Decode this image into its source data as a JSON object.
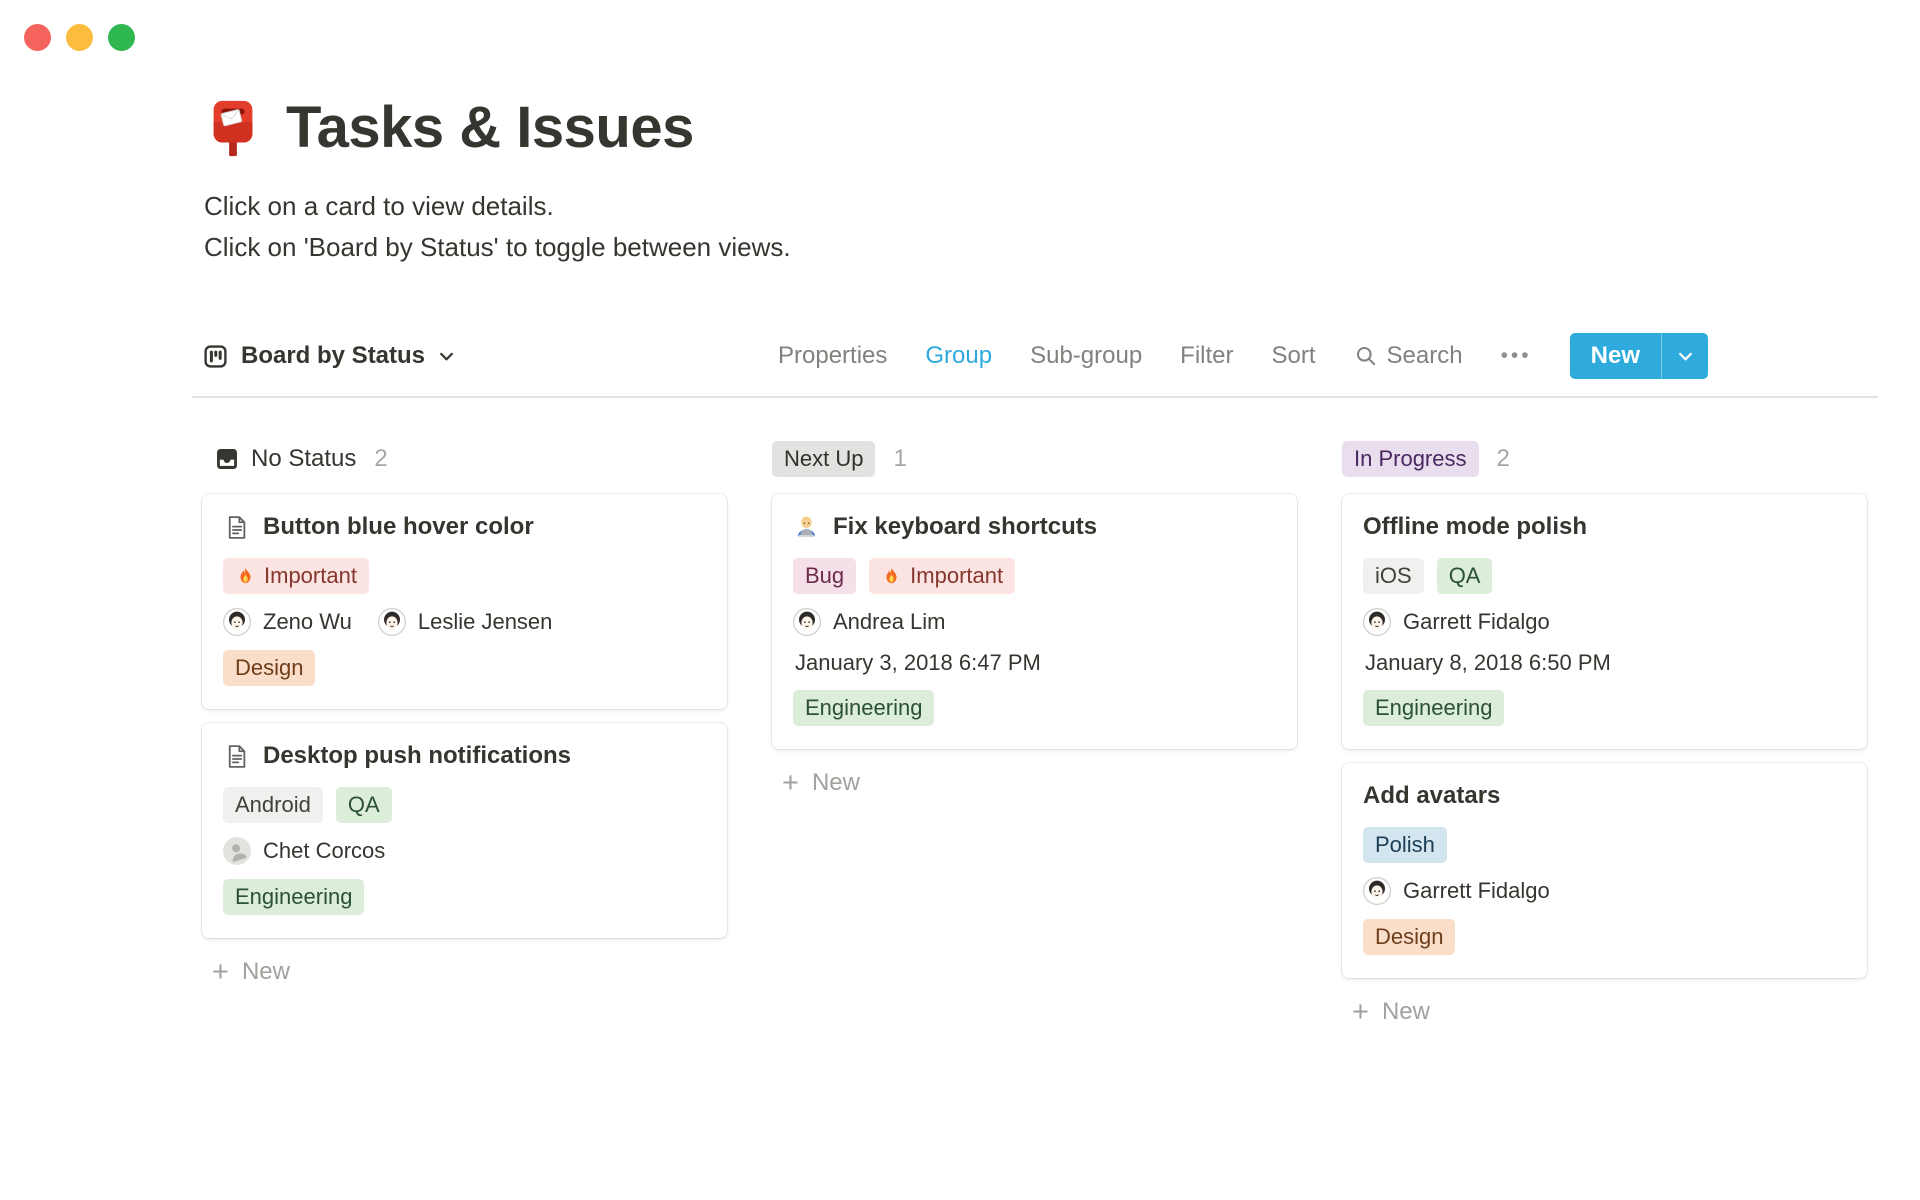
{
  "page": {
    "icon": "postbox",
    "title": "Tasks & Issues",
    "description_lines": [
      "Click on a card to view details.",
      "Click on 'Board by Status' to toggle between views."
    ]
  },
  "toolbar": {
    "view_selector": {
      "icon": "board",
      "label": "Board by Status"
    },
    "menu_items": [
      {
        "label": "Properties",
        "active": false
      },
      {
        "label": "Group",
        "active": true
      },
      {
        "label": "Sub-group",
        "active": false
      },
      {
        "label": "Filter",
        "active": false
      },
      {
        "label": "Sort",
        "active": false
      }
    ],
    "search_label": "Search",
    "more_label": "•••",
    "new_button_label": "New"
  },
  "board": {
    "columns": [
      {
        "title": "No Status",
        "count": "2",
        "header_style": "icon-plain",
        "header_icon": "inbox",
        "new_label": "New",
        "cards": [
          {
            "icon": "page",
            "title": "Button blue hover color",
            "tags": [
              {
                "label": "Important",
                "color": "red",
                "icon": "fire"
              }
            ],
            "people": [
              {
                "name": "Zeno Wu",
                "avatar": "photo"
              },
              {
                "name": "Leslie Jensen",
                "avatar": "photo"
              }
            ],
            "bottom_tags": [
              {
                "label": "Design",
                "color": "orange"
              }
            ]
          },
          {
            "icon": "page",
            "title": "Desktop push notifications",
            "tags": [
              {
                "label": "Android",
                "color": "lightgray"
              },
              {
                "label": "QA",
                "color": "green"
              }
            ],
            "people": [
              {
                "name": "Chet Corcos",
                "avatar": "placeholder"
              }
            ],
            "bottom_tags": [
              {
                "label": "Engineering",
                "color": "green"
              }
            ]
          }
        ]
      },
      {
        "title": "Next Up",
        "count": "1",
        "header_style": "badge",
        "header_color": "gray",
        "new_label": "New",
        "cards": [
          {
            "icon": "technologist",
            "title": "Fix keyboard shortcuts",
            "tags": [
              {
                "label": "Bug",
                "color": "pink"
              },
              {
                "label": "Important",
                "color": "red",
                "icon": "fire"
              }
            ],
            "people": [
              {
                "name": "Andrea Lim",
                "avatar": "photo"
              }
            ],
            "date": "January 3, 2018 6:47 PM",
            "bottom_tags": [
              {
                "label": "Engineering",
                "color": "green"
              }
            ]
          }
        ]
      },
      {
        "title": "In Progress",
        "count": "2",
        "header_style": "badge",
        "header_color": "purple",
        "new_label": "New",
        "cards": [
          {
            "icon": null,
            "title": "Offline mode polish",
            "tags": [
              {
                "label": "iOS",
                "color": "lightgray"
              },
              {
                "label": "QA",
                "color": "green"
              }
            ],
            "people": [
              {
                "name": "Garrett Fidalgo",
                "avatar": "photo"
              }
            ],
            "date": "January 8, 2018 6:50 PM",
            "bottom_tags": [
              {
                "label": "Engineering",
                "color": "green"
              }
            ]
          },
          {
            "icon": null,
            "title": "Add avatars",
            "tags": [
              {
                "label": "Polish",
                "color": "blue"
              }
            ],
            "people": [
              {
                "name": "Garrett Fidalgo",
                "avatar": "photo"
              }
            ],
            "bottom_tags": [
              {
                "label": "Design",
                "color": "orange"
              }
            ]
          }
        ]
      }
    ]
  },
  "colors": {
    "accent": "#2eaadc",
    "text": "#37352f",
    "muted": "#9b9a97",
    "toolbar_inactive": "#82817d",
    "divider": "#e4e3e1",
    "traffic_red": "#f4645c",
    "traffic_yellow": "#fcbd3e",
    "traffic_green": "#2fb750",
    "tag_red_bg": "#fbe4e1",
    "tag_red_text": "#85372f",
    "tag_orange_bg": "#fadeca",
    "tag_orange_text": "#6e3e1b",
    "tag_green_bg": "#dcedda",
    "tag_green_text": "#2b5138",
    "tag_blue_bg": "#d3e5ef",
    "tag_blue_text": "#1d3e55",
    "tag_purple_bg": "#e8deee",
    "tag_purple_text": "#49275f",
    "tag_pink_bg": "#f5e0e9",
    "tag_pink_text": "#6d2c4d",
    "tag_gray_bg": "#e3e2e0",
    "tag_gray_text": "#32302c",
    "tag_lightgray_bg": "#f0f0ee",
    "tag_lightgray_text": "#42403c"
  }
}
